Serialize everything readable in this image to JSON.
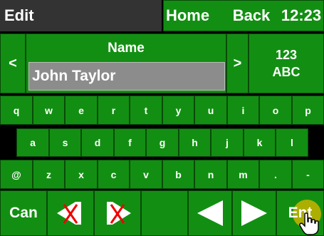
{
  "colors": {
    "key_green": "#128f12",
    "title_bar": "#333333",
    "field_bg": "#8c8c8c",
    "background": "#000000"
  },
  "header": {
    "title": "Edit",
    "home_label": "Home",
    "back_label": "Back",
    "clock": "12:23"
  },
  "field": {
    "prev_label": "<",
    "next_label": ">",
    "label": "Name",
    "value": "John Taylor",
    "mode_top": "123",
    "mode_bottom": "ABC"
  },
  "keyboard": {
    "row1": [
      "q",
      "w",
      "e",
      "r",
      "t",
      "y",
      "u",
      "i",
      "o",
      "p"
    ],
    "row2": [
      "a",
      "s",
      "d",
      "f",
      "g",
      "h",
      "j",
      "k",
      "l"
    ],
    "row3": [
      "@",
      "z",
      "x",
      "c",
      "v",
      "b",
      "n",
      "m",
      ".",
      "-"
    ]
  },
  "bottom": {
    "cancel_label": "Can",
    "enter_label": "Ent",
    "icons": [
      "delete-left-icon",
      "delete-right-icon",
      "cursor-left-icon",
      "cursor-right-icon",
      "hand-pointer-icon"
    ]
  }
}
